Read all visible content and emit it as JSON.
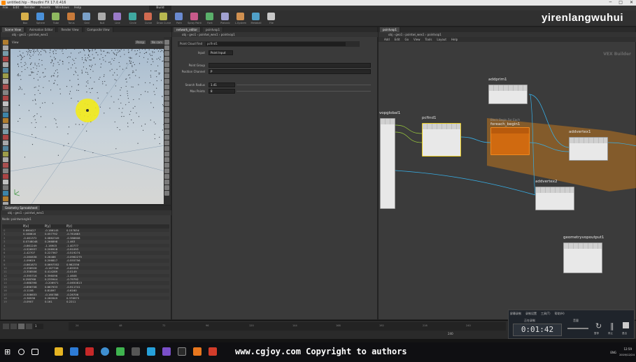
{
  "window": {
    "title": "untitled.hip - Houdini FX 17.0.416"
  },
  "menu": [
    "File",
    "Edit",
    "Render",
    "Assets",
    "Windows",
    "Help"
  ],
  "desktop_label": "Build",
  "watermark_top": "yirenlangwuhui",
  "shelf_tools": [
    "Box",
    "Sphere",
    "Tube",
    "Torus",
    "Grid",
    "Null",
    "Line",
    "Circle",
    "Curve",
    "Draw Curve",
    "Path",
    "Spray Paint",
    "Font",
    "Platonic",
    "L-System",
    "Metaball",
    "File"
  ],
  "viewport": {
    "tabs": [
      "Scene View",
      "Animation Editor",
      "Render View",
      "Composite View"
    ],
    "view_label": "View",
    "persp": "Persp",
    "cam": "No cam",
    "path": [
      "obj",
      "geo1",
      "pointwi_wex1"
    ]
  },
  "spreadsheet": {
    "tabs": [
      "Geometry Spreadsheet"
    ],
    "node_label": "Node: pointwrangle1",
    "columns": [
      "",
      "P[x]",
      "P[y]",
      "P[z]"
    ],
    "rows": [
      [
        "0",
        "0.690427",
        "-0.186145",
        "0.157834"
      ],
      [
        "1",
        "0.168616",
        "0.057792",
        "-0.761683"
      ],
      [
        "2",
        "-0.461372",
        "0.0862349",
        "-0.388608"
      ],
      [
        "3",
        "0.0748048",
        "0.266898",
        "-1.463"
      ],
      [
        "4",
        "-0.861249",
        "-1.16903",
        "-1.40777"
      ],
      [
        "5",
        "-0.526937",
        "0.206918",
        "-0.91093"
      ],
      [
        "6",
        "-1.42707",
        "0.227367",
        "-0.519274"
      ],
      [
        "7",
        "-0.280838",
        "0.28486",
        "-0.0962275"
      ],
      [
        "8",
        "-1.09619",
        "0.206817",
        "-0.555756"
      ],
      [
        "9",
        "-0.861873",
        "0.0697352",
        "0.982336"
      ],
      [
        "10",
        "-0.258928",
        "-0.167746",
        "-0.85555"
      ],
      [
        "11",
        "-0.358506",
        "0.414289",
        "-0.0149"
      ],
      [
        "12",
        "-0.395716",
        "0.396096",
        "-1.4608"
      ],
      [
        "13",
        "0.258768",
        "0.235944",
        "-0.79792"
      ],
      [
        "14",
        "-0.688398",
        "-0.206971",
        "-0.0650813"
      ],
      [
        "15",
        "-0.896708",
        "0.667933",
        "-0.911741"
      ],
      [
        "16",
        "-0.1106",
        "0.81897",
        "-0.6160"
      ],
      [
        "17",
        "-0.308633",
        "-0.160788",
        "-0.26706"
      ],
      [
        "18",
        "-0.36938",
        "0.260949",
        "0.376975"
      ],
      [
        "19",
        "-0.0907",
        "0.161",
        "0.2211"
      ]
    ]
  },
  "params": {
    "node_type": "Point Cloud Find",
    "node_name": "pcfind1",
    "tabs": [
      "network_editor",
      "pointvop1"
    ],
    "path": [
      "obj",
      "geo1",
      "pointwi_wex1",
      "pointvop1"
    ],
    "fields": [
      {
        "label": "Input",
        "value": "Point Input"
      },
      {
        "label": "Point Group",
        "value": ""
      },
      {
        "label": "Position Channel",
        "value": "P"
      },
      {
        "label": "Search Radius",
        "value": "1.41"
      },
      {
        "label": "Max Points",
        "value": "8"
      }
    ]
  },
  "network": {
    "path": [
      "obj",
      "geo1",
      "pointwi_wex1",
      "pointvop1"
    ],
    "menu": [
      "Add",
      "Edit",
      "Go",
      "View",
      "Tools",
      "Layout",
      "Help"
    ],
    "context_label": "VEX Builder",
    "nodes": [
      {
        "id": "vopglobal",
        "label": "vopglobal1"
      },
      {
        "id": "pcfind",
        "label": "pcfind1"
      },
      {
        "id": "foreach",
        "label": "foreach_begin1",
        "block": "Block Begin For Each"
      },
      {
        "id": "addprim",
        "label": "addprim1"
      },
      {
        "id": "addvertex1",
        "label": "addvertex1"
      },
      {
        "id": "addvertex2",
        "label": "addvertex2"
      },
      {
        "id": "geoout",
        "label": "geometryvopoutput1"
      }
    ]
  },
  "timeline": {
    "frame": "1",
    "end": "240",
    "ticks": [
      "24",
      "48",
      "72",
      "96",
      "120",
      "144",
      "168",
      "192",
      "216",
      "240"
    ]
  },
  "recorder": {
    "time": "0:01:42",
    "menu": [
      "屏幕录制",
      "录制设置",
      "工具(T)",
      "帮助(H)"
    ],
    "status": "正在录制",
    "volume": "音量",
    "btns": [
      "暂停",
      "停止",
      "退出"
    ]
  },
  "taskbar": {
    "clock": "12:59",
    "date": "2019/12/24",
    "lang": "ENG"
  },
  "copyright": "www.cgjoy.com Copyright to authors",
  "colors": {
    "accent": "#ff8a00",
    "wire": "#37b0e8",
    "selected": "#e5c820"
  }
}
